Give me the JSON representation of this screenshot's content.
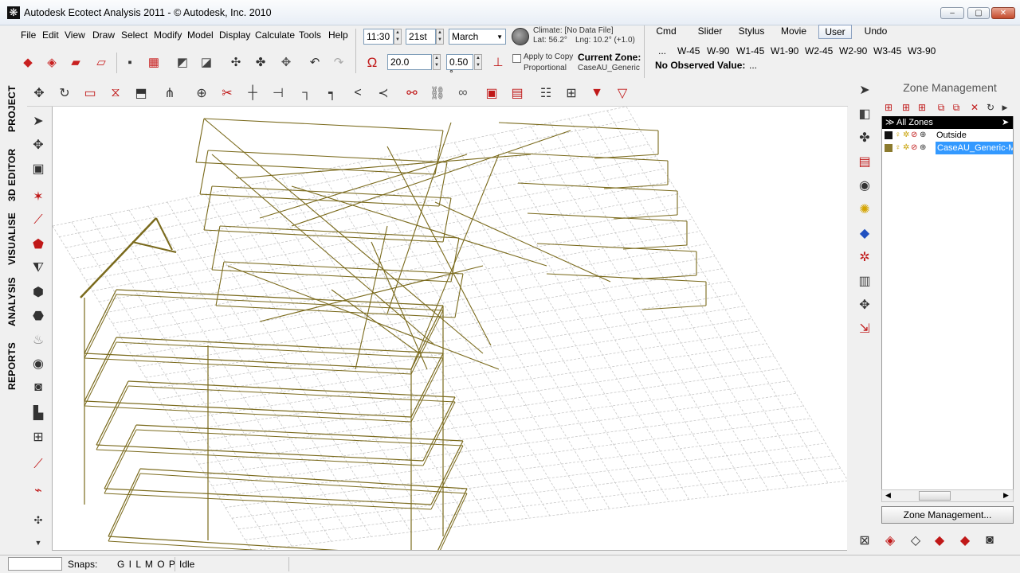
{
  "window": {
    "title": "Autodesk Ecotect Analysis 2011 - © Autodesk, Inc. 2010",
    "app_glyph": "❋",
    "minimize": "–",
    "maximize": "▢",
    "close": "✕"
  },
  "menu": {
    "items": [
      "File",
      "Edit",
      "View",
      "Draw",
      "Select",
      "Modify",
      "Model",
      "Display",
      "Calculate",
      "Tools",
      "Help"
    ]
  },
  "time": {
    "clock": "11:30",
    "day": "21st",
    "month": "March"
  },
  "climate": {
    "label": "Climate: [No Data File]",
    "lat": "Lat: 56.2°",
    "lng": "Lng: 10.2° (+1.0)"
  },
  "scale": {
    "value1": "20.0",
    "value2": "0.50 °",
    "apply_copy": "Apply to Copy",
    "proportional": "Proportional"
  },
  "zone": {
    "label": "Current Zone:",
    "value": "CaseAU_Generic-f"
  },
  "command_tabs": {
    "tabs": [
      "Cmd",
      "Slider",
      "Stylus",
      "Movie",
      "User",
      "Undo"
    ],
    "active": "User"
  },
  "workplane": {
    "ellipsis": "...",
    "buttons": [
      "W-45",
      "W-90",
      "W1-45",
      "W1-90",
      "W2-45",
      "W2-90",
      "W3-45",
      "W3-90"
    ],
    "observed_label": "No Observed Value:",
    "observed_value": "..."
  },
  "left_tabs": [
    "PROJECT",
    "3D EDITOR",
    "VISUALISE",
    "ANALYSIS",
    "REPORTS"
  ],
  "zone_panel": {
    "title": "Zone Management",
    "all_zones": "All Zones",
    "zones": [
      {
        "name": "Outside",
        "swatch": "#111111",
        "selected": false
      },
      {
        "name": "CaseAU_Generic-M",
        "swatch": "#8b7a2e",
        "selected": true
      }
    ],
    "button": "Zone Management..."
  },
  "status": {
    "snaps_label": "Snaps:",
    "snaps_value": "G I  L  M O P",
    "state": "Idle"
  },
  "colors": {
    "wire": "#7a6a1c",
    "grid": "#c8c8c8",
    "selection": "#3399ff"
  }
}
